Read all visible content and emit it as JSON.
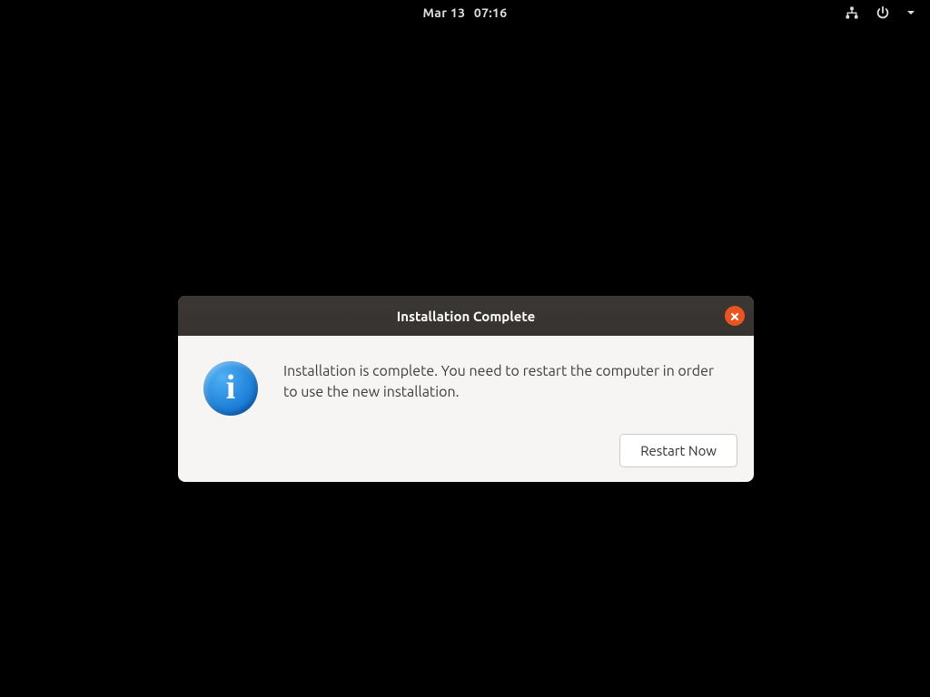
{
  "topbar": {
    "clock_date": "Mar 13",
    "clock_time": "07:16"
  },
  "dialog": {
    "title": "Installation Complete",
    "message": "Installation is complete. You need to restart the computer in order to use the new installation.",
    "restart_label": "Restart Now",
    "info_icon_name": "info-icon",
    "close_icon_name": "close-icon"
  }
}
